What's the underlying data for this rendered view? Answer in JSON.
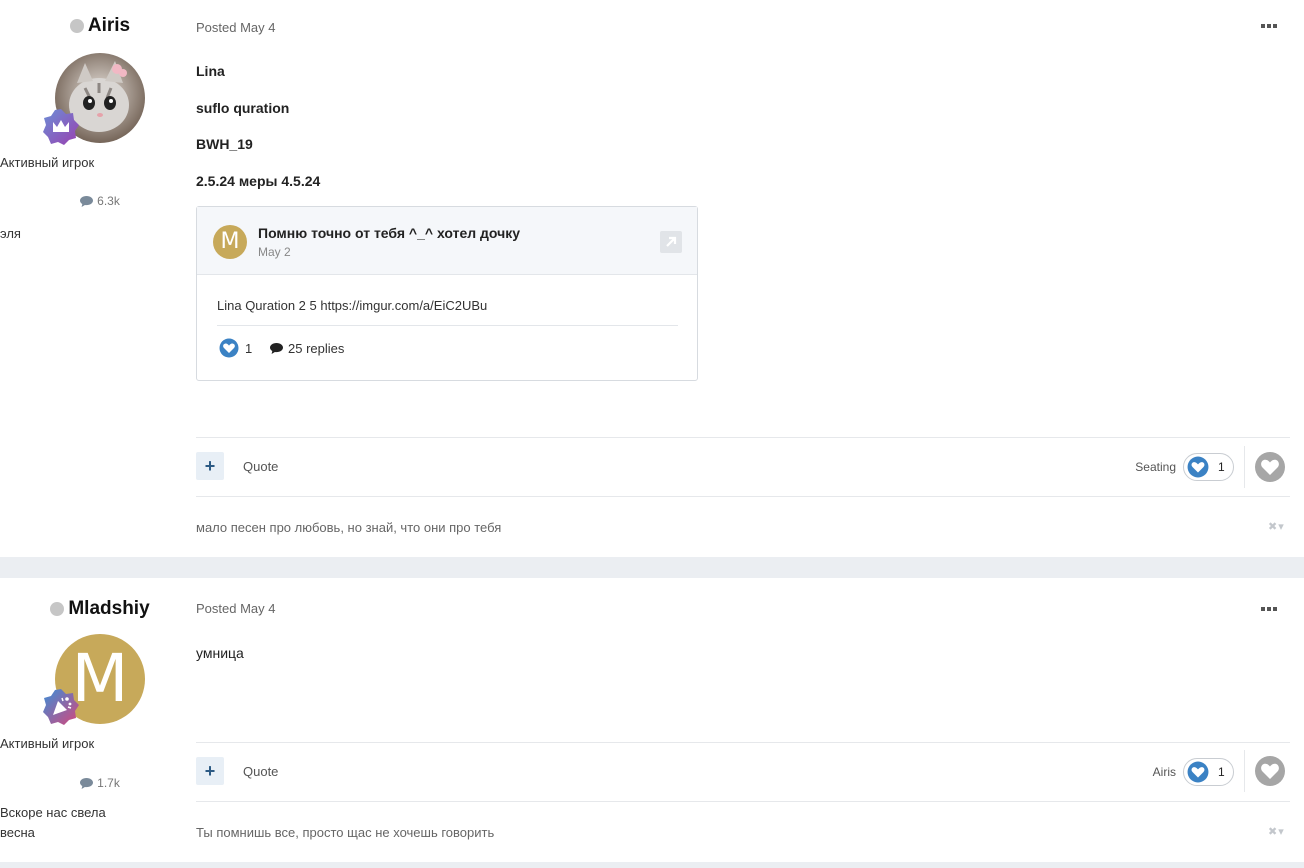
{
  "posts": [
    {
      "author": "Airis",
      "rank": "Активный игрок",
      "post_count": "6.3k",
      "author_subtitle": "эля",
      "posted": "Posted May 4",
      "lines": [
        "Lina",
        "suflo quration",
        "BWH_19",
        "2.5.24 меры 4.5.24"
      ],
      "embed": {
        "avatar_letter": "M",
        "title": "Помню точно от тебя ^_^ хотел дочку",
        "date": "May 2",
        "body": "Lina Quration 2 5 https://imgur.com/a/EiC2UBu",
        "reactions": "1",
        "replies": "25 replies"
      },
      "quote_label": "Quote",
      "plus_label": "+",
      "reaction_user": "Seating",
      "reaction_count": "1",
      "signature": "мало песен про любовь, но знай, что они про тебя",
      "signature_controls": "✖▾"
    },
    {
      "author": "Mladshiy",
      "avatar_letter": "M",
      "rank": "Активный игрок",
      "post_count": "1.7k",
      "author_subtitle_1": "Вскоре нас свела",
      "author_subtitle_2": "весна",
      "posted": "Posted May 4",
      "text": "умница",
      "quote_label": "Quote",
      "plus_label": "+",
      "reaction_user": "Airis",
      "reaction_count": "1",
      "signature": "Ты помнишь все, просто щас не хочешь говорить",
      "signature_controls": "✖▾"
    }
  ],
  "colors": {
    "accent": "#2c5a84",
    "reaction_heart": "#3b82c4",
    "avatar_gold": "#c7a95a",
    "background": "#ebeef2"
  },
  "icons": {
    "comment": "comment-icon",
    "heart": "heart-icon",
    "more": "more-dots-icon",
    "link": "external-link-icon",
    "online": "status-dot-icon"
  }
}
